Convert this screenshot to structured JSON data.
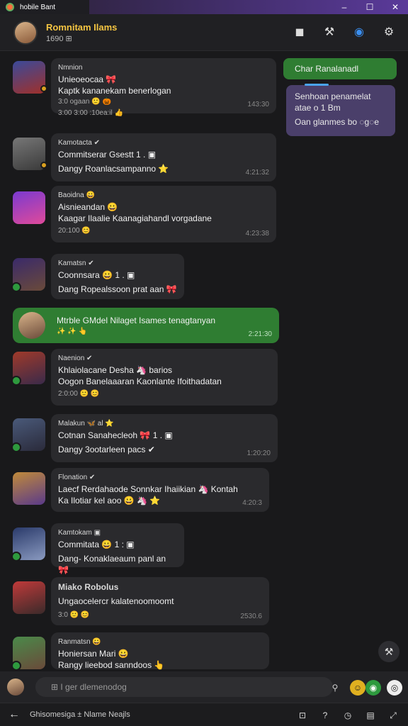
{
  "window": {
    "title": "hobile Bant",
    "controls": [
      "–",
      "☐",
      "✕"
    ]
  },
  "header": {
    "name": "Romnitam Ilams",
    "sub": "1690 ⊞",
    "actions": [
      "stop-icon",
      "tools-icon",
      "circle-icon",
      "settings-icon"
    ]
  },
  "outgoing": {
    "green": "Char Ranalanadl",
    "purple": {
      "line1": "Senhoan penamelat",
      "line2": "atae o 1 Bm",
      "line3": "Oan glanmes bo ◌g◌e"
    }
  },
  "messages": [
    {
      "who": "Nmnion",
      "line1": "Unieoeocaa 🎀",
      "line2": "Kaptk kananekam benerlogan",
      "meta": "3:0 ogaan 🙂 🎃",
      "meta2": "3:00 3:00 :10ea:il 👍",
      "time": "143:30"
    },
    {
      "who": "Kamotacta ✔",
      "line1": "Commitserar Gsestt 1 . ▣",
      "line2": "Dangy  Roanlacsampanno ⭐",
      "time": "4:21:32"
    },
    {
      "who": "Baoidna 😀",
      "line1": "Aisnieandan 😀",
      "line2": "Kaagar Ilaalie Kaanagiahandl vorgadane",
      "meta": "20:100 😊",
      "time": "4:23:38"
    },
    {
      "who": "Kamatsn ✔",
      "line1": "Coonnsara 😀 1 . ▣",
      "line2": "Dang  Ropealssoon prat aan 🎀",
      "time": ""
    },
    {
      "who": "",
      "line1": "Mtrble GMdel Nilaget Isames tenagtanyan",
      "line2": "✨ ✨ 👆",
      "time": "2:21:30",
      "green": true
    },
    {
      "who": "Naenion ✔",
      "line1": "Khlaiolacane Desha 🦄 barios",
      "line2": "Oogon Banelaaaran Kaonlante Ifoithadatan",
      "meta": "2:0:00 🙂 😊",
      "time": ""
    },
    {
      "who": "Malakun 🦋 al ⭐",
      "line1": "Cotnan Sanahecleoh 🎀 1 . ▣",
      "line2": "Dangy 3ootarleen pacs ✔",
      "time": "1:20:20"
    },
    {
      "who": "Flonation ✔",
      "line1": "Laecf Rerdahaode Sonnkar Ihaiikian 🦄 Kontah",
      "line2": "Ka Ilotiar kel aoo 😀 🦄 ⭐",
      "time": "4:20:3"
    },
    {
      "who": "Kamtokam ▣",
      "line1": "Commitata 😀 1 : ▣",
      "line2": "Dang-  Konaklaeaum panl an 🎀",
      "time": ""
    },
    {
      "who": "Miako Robolus",
      "line1": "Ungaocelercr kalatenoomoomt",
      "line2": "3:0 🙂 😊",
      "time": "2530.6"
    },
    {
      "who": "Ranmatsn 😀",
      "line1": "Honiersan Mari 😀",
      "line2": "Rangy lieebod sanndoos 👆",
      "time": ""
    }
  ],
  "composer": {
    "placeholder": "⊞ I ger dlemenodog"
  },
  "bottombar": {
    "text": "Ghisomesiga ± Nlame Neajls"
  }
}
